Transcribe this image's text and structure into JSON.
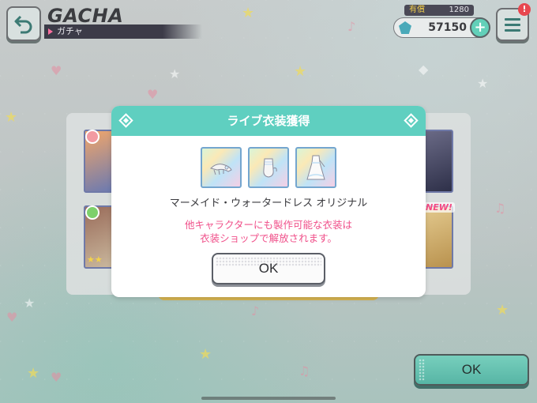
{
  "header": {
    "title": "GACHA",
    "subtitle": "ガチャ"
  },
  "currency": {
    "paid_label": "有償",
    "paid_amount": "1280",
    "gem_amount": "57150",
    "add_label": "+"
  },
  "menu": {
    "notification_count": "!"
  },
  "background": {
    "new_tag": "NEW!",
    "bottom_ok_label": "OK"
  },
  "dialog": {
    "title": "ライブ衣装獲得",
    "items": [
      {
        "icon": "accessory-icon"
      },
      {
        "icon": "gloves-icon"
      },
      {
        "icon": "dress-icon"
      }
    ],
    "costume_name": "マーメイド・ウォータードレス オリジナル",
    "notice_line1": "他キャラクターにも製作可能な衣装は",
    "notice_line2": "衣装ショップで解放されます。",
    "ok_label": "OK"
  },
  "colors": {
    "dialog_header": "#5fcfc0",
    "notice_text": "#f0508a",
    "accent_teal": "#62d0b9"
  }
}
